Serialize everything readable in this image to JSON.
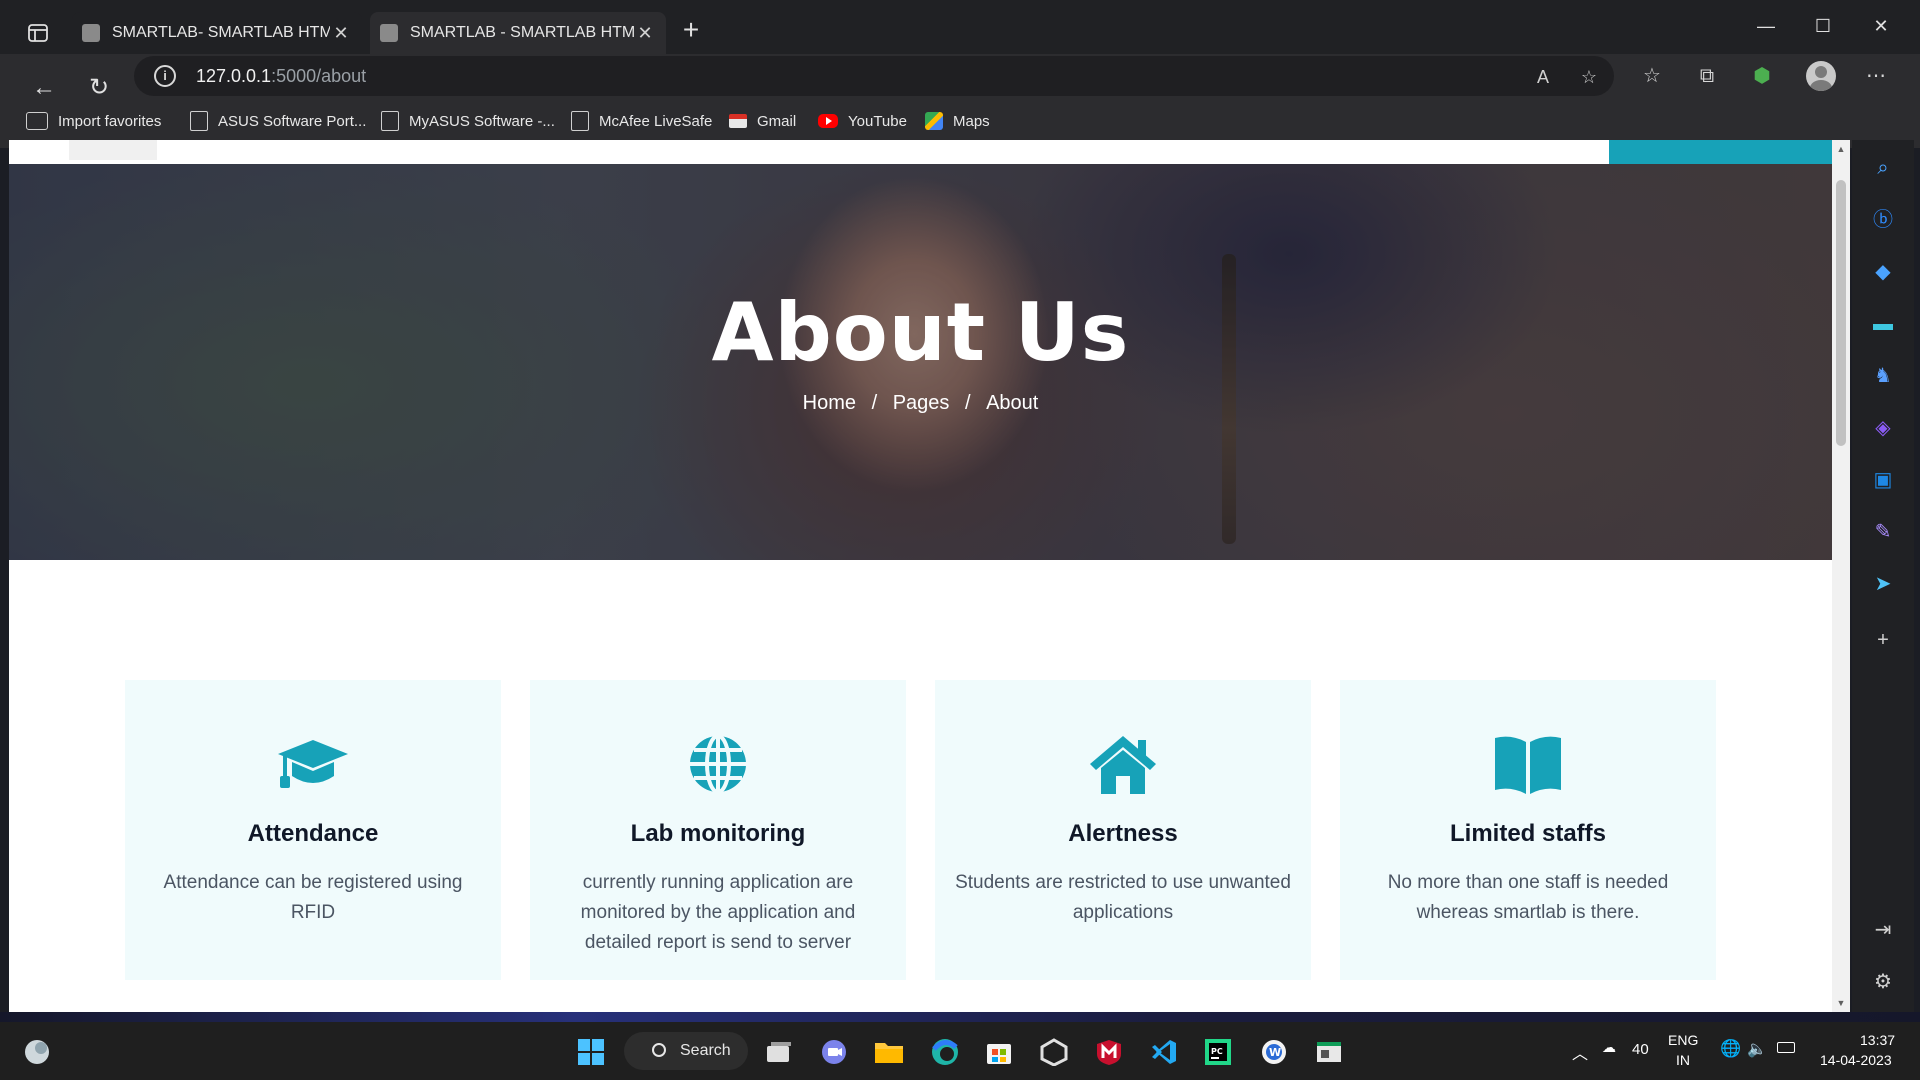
{
  "browser": {
    "tabs": [
      {
        "title": "SMARTLAB- SMARTLAB HTML Te",
        "active": false
      },
      {
        "title": "SMARTLAB - SMARTLAB HTML Te",
        "active": true
      }
    ],
    "url_host": "127.0.0.1",
    "url_rest": ":5000/about",
    "bookmarks": [
      {
        "label": "Import favorites",
        "icon": "import-icon"
      },
      {
        "label": "ASUS Software Port...",
        "icon": "page-icon"
      },
      {
        "label": "MyASUS Software -...",
        "icon": "page-icon"
      },
      {
        "label": "McAfee LiveSafe",
        "icon": "page-icon"
      },
      {
        "label": "Gmail",
        "icon": "gmail-icon"
      },
      {
        "label": "YouTube",
        "icon": "youtube-icon"
      },
      {
        "label": "Maps",
        "icon": "maps-icon"
      }
    ]
  },
  "page": {
    "hero_title": "About Us",
    "breadcrumb": {
      "home": "Home",
      "sep": "/",
      "pages": "Pages",
      "current": "About"
    },
    "features": [
      {
        "icon": "graduation-cap-icon",
        "title": "Attendance",
        "text": "Attendance can be registered using RFID"
      },
      {
        "icon": "globe-icon",
        "title": "Lab monitoring",
        "text": "currently running application are monitored by the application and detailed report is send to server"
      },
      {
        "icon": "home-icon",
        "title": "Alertness",
        "text": "Students are restricted to use unwanted applications"
      },
      {
        "icon": "book-open-icon",
        "title": "Limited staffs",
        "text": "No more than one staff is needed whereas smartlab is there."
      }
    ],
    "accent_color": "#17a2b8"
  },
  "taskbar": {
    "search_label": "Search",
    "temperature": "40",
    "lang_top": "ENG",
    "lang_bottom": "IN",
    "time": "13:37",
    "date": "14-04-2023"
  }
}
